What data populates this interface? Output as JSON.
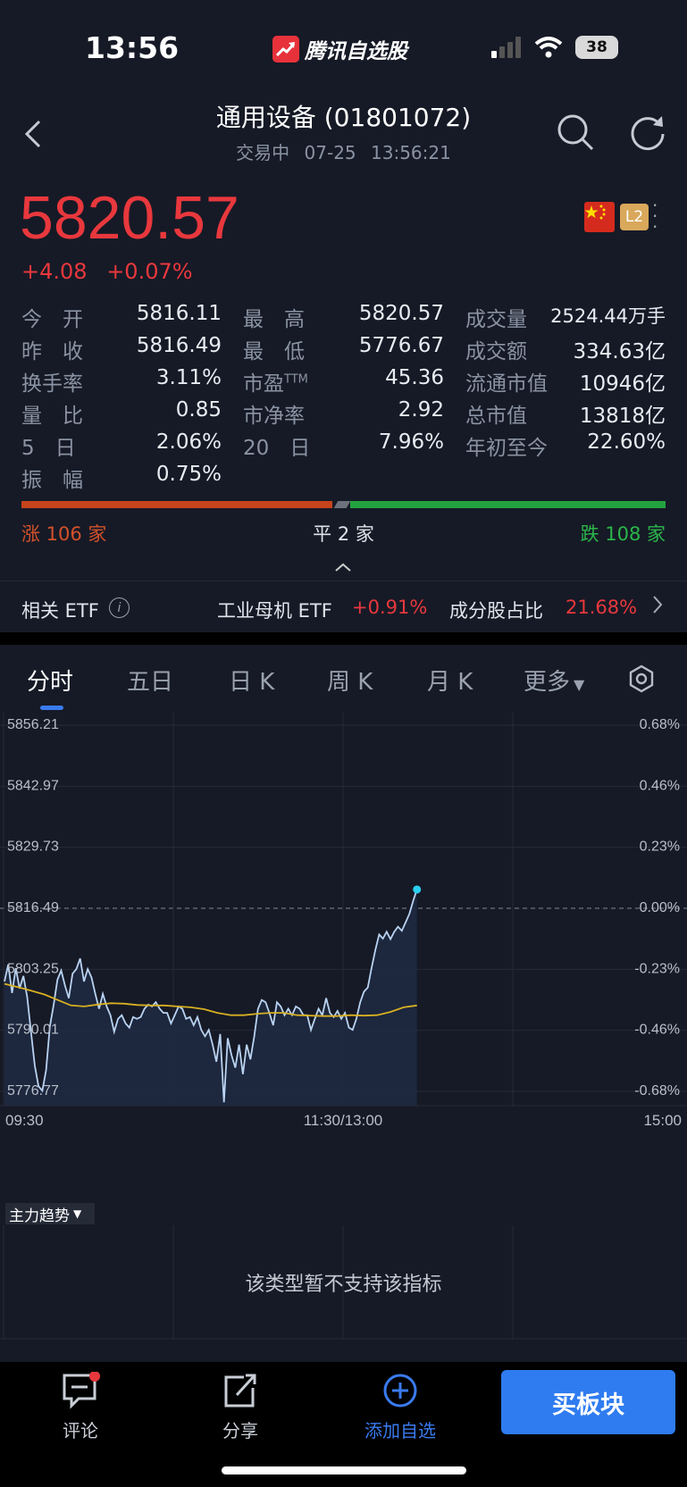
{
  "status_bar": {
    "time": "13:56",
    "app_name": "腾讯自选股",
    "battery": "38"
  },
  "header": {
    "title": "通用设备 (01801072)",
    "subtitle": "交易中   07-25 13:56:21"
  },
  "quote": {
    "price": "5820.57",
    "change": "+4.08",
    "change_pct": "+0.07%",
    "badge": "L2",
    "colors": {
      "up": "#e8383d",
      "down": "#2bb64a"
    }
  },
  "stats": {
    "open_label": "今　开",
    "open": "5816.11",
    "prev_close_label": "昨　收",
    "prev_close": "5816.49",
    "turnover_label": "换手率",
    "turnover": "3.11%",
    "volume_ratio_label": "量　比",
    "volume_ratio": "0.85",
    "five_day_label": "5　日",
    "five_day": "2.06%",
    "amplitude_label": "振　幅",
    "amplitude": "0.75%",
    "high_label": "最　高",
    "high": "5820.57",
    "low_label": "最　低",
    "low": "5776.67",
    "pe_label": "市盈",
    "pe_sup": "TTM",
    "pe": "45.36",
    "pb_label": "市净率",
    "pb": "2.92",
    "twenty_day_label": "20　日",
    "twenty_day": "7.96%",
    "volume_label": "成交量",
    "volume": "2524.44万手",
    "amount_label": "成交额",
    "amount": "334.63亿",
    "float_cap_label": "流通市值",
    "float_cap": "10946亿",
    "total_cap_label": "总市值",
    "total_cap": "13818亿",
    "ytd_label": "年初至今",
    "ytd": "22.60%"
  },
  "breadth": {
    "up": "涨 106 家",
    "flat": "平 2 家",
    "down": "跌 108 家",
    "up_count": 106,
    "flat_count": 2,
    "down_count": 108
  },
  "etf": {
    "label": "相关 ETF",
    "name": "工业母机 ETF",
    "change": "+0.91%",
    "weight_label": "成分股占比",
    "weight": "21.68%"
  },
  "tabs": [
    "分时",
    "五日",
    "日 K",
    "周 K",
    "月 K",
    "更多"
  ],
  "chart_data": {
    "type": "line",
    "y_ticks": [
      "5856.21",
      "5842.97",
      "5829.73",
      "5816.49",
      "5803.25",
      "5790.01",
      "5776.77"
    ],
    "pct_ticks": [
      "0.68%",
      "0.46%",
      "0.23%",
      "0.00%",
      "-0.23%",
      "-0.46%",
      "-0.68%"
    ],
    "x_ticks": [
      "09:30",
      "11:30/13:00",
      "15:00"
    ],
    "ylim": [
      5776.77,
      5856.21
    ],
    "prev_close": 5816.49,
    "series": [
      {
        "values": [
          5800.6,
          5804.3,
          5798.1,
          5803.5,
          5799.1,
          5801.8,
          5797.3,
          5789.7,
          5782.4,
          5777.9,
          5776.9,
          5781.4,
          5790.8,
          5795.6,
          5801.0,
          5803.0,
          5799.7,
          5797.0,
          5802.3,
          5803.3,
          5805.6,
          5800.6,
          5803.3,
          5801.5,
          5797.9,
          5794.7,
          5797.9,
          5795.2,
          5793.3,
          5789.7,
          5792.5,
          5793.3,
          5791.5,
          5790.6,
          5792.9,
          5792.5,
          5792.9,
          5794.7,
          5795.6,
          5795.2,
          5796.1,
          5794.7,
          5793.8,
          5793.8,
          5791.5,
          5793.3,
          5795.2,
          5794.7,
          5792.5,
          5792.9,
          5791.1,
          5792.9,
          5790.1,
          5788.7,
          5790.1,
          5786.9,
          5783.2,
          5789.2,
          5774.4,
          5788.3,
          5784.6,
          5781.9,
          5786.9,
          5780.5,
          5786.9,
          5783.7,
          5788.7,
          5794.7,
          5796.6,
          5796.1,
          5793.8,
          5791.1,
          5796.1,
          5795.2,
          5793.3,
          5794.7,
          5793.3,
          5795.2,
          5794.7,
          5793.3,
          5793.3,
          5790.1,
          5792.5,
          5794.7,
          5793.3,
          5797.0,
          5793.8,
          5792.9,
          5794.2,
          5792.5,
          5793.8,
          5790.6,
          5790.1,
          5792.5,
          5796.1,
          5798.4,
          5799.3,
          5803.5,
          5807.4,
          5810.8,
          5809.9,
          5811.4,
          5809.8,
          5811.4,
          5812.5,
          5811.6,
          5813.4,
          5815.3,
          5818.1,
          5820.57
        ]
      },
      {
        "values": [
          5800.1,
          5799.4,
          5798.6,
          5797.8,
          5796.6,
          5795.4,
          5795.2,
          5795.6,
          5795.9,
          5795.8,
          5795.5,
          5795.4,
          5795.4,
          5795.2,
          5795.0,
          5794.6,
          5793.8,
          5793.3,
          5793.3,
          5793.6,
          5793.8,
          5793.8,
          5793.3,
          5793.2,
          5793.1,
          5793.1,
          5793.3,
          5793.2,
          5793.3,
          5794.0,
          5795.0,
          5795.4
        ]
      }
    ]
  },
  "indicator": {
    "select": "主力趋势",
    "message": "该类型暂不支持该指标"
  },
  "bottom_bar": {
    "comment": "评论",
    "share": "分享",
    "add_watch": "添加自选",
    "buy": "买板块"
  }
}
